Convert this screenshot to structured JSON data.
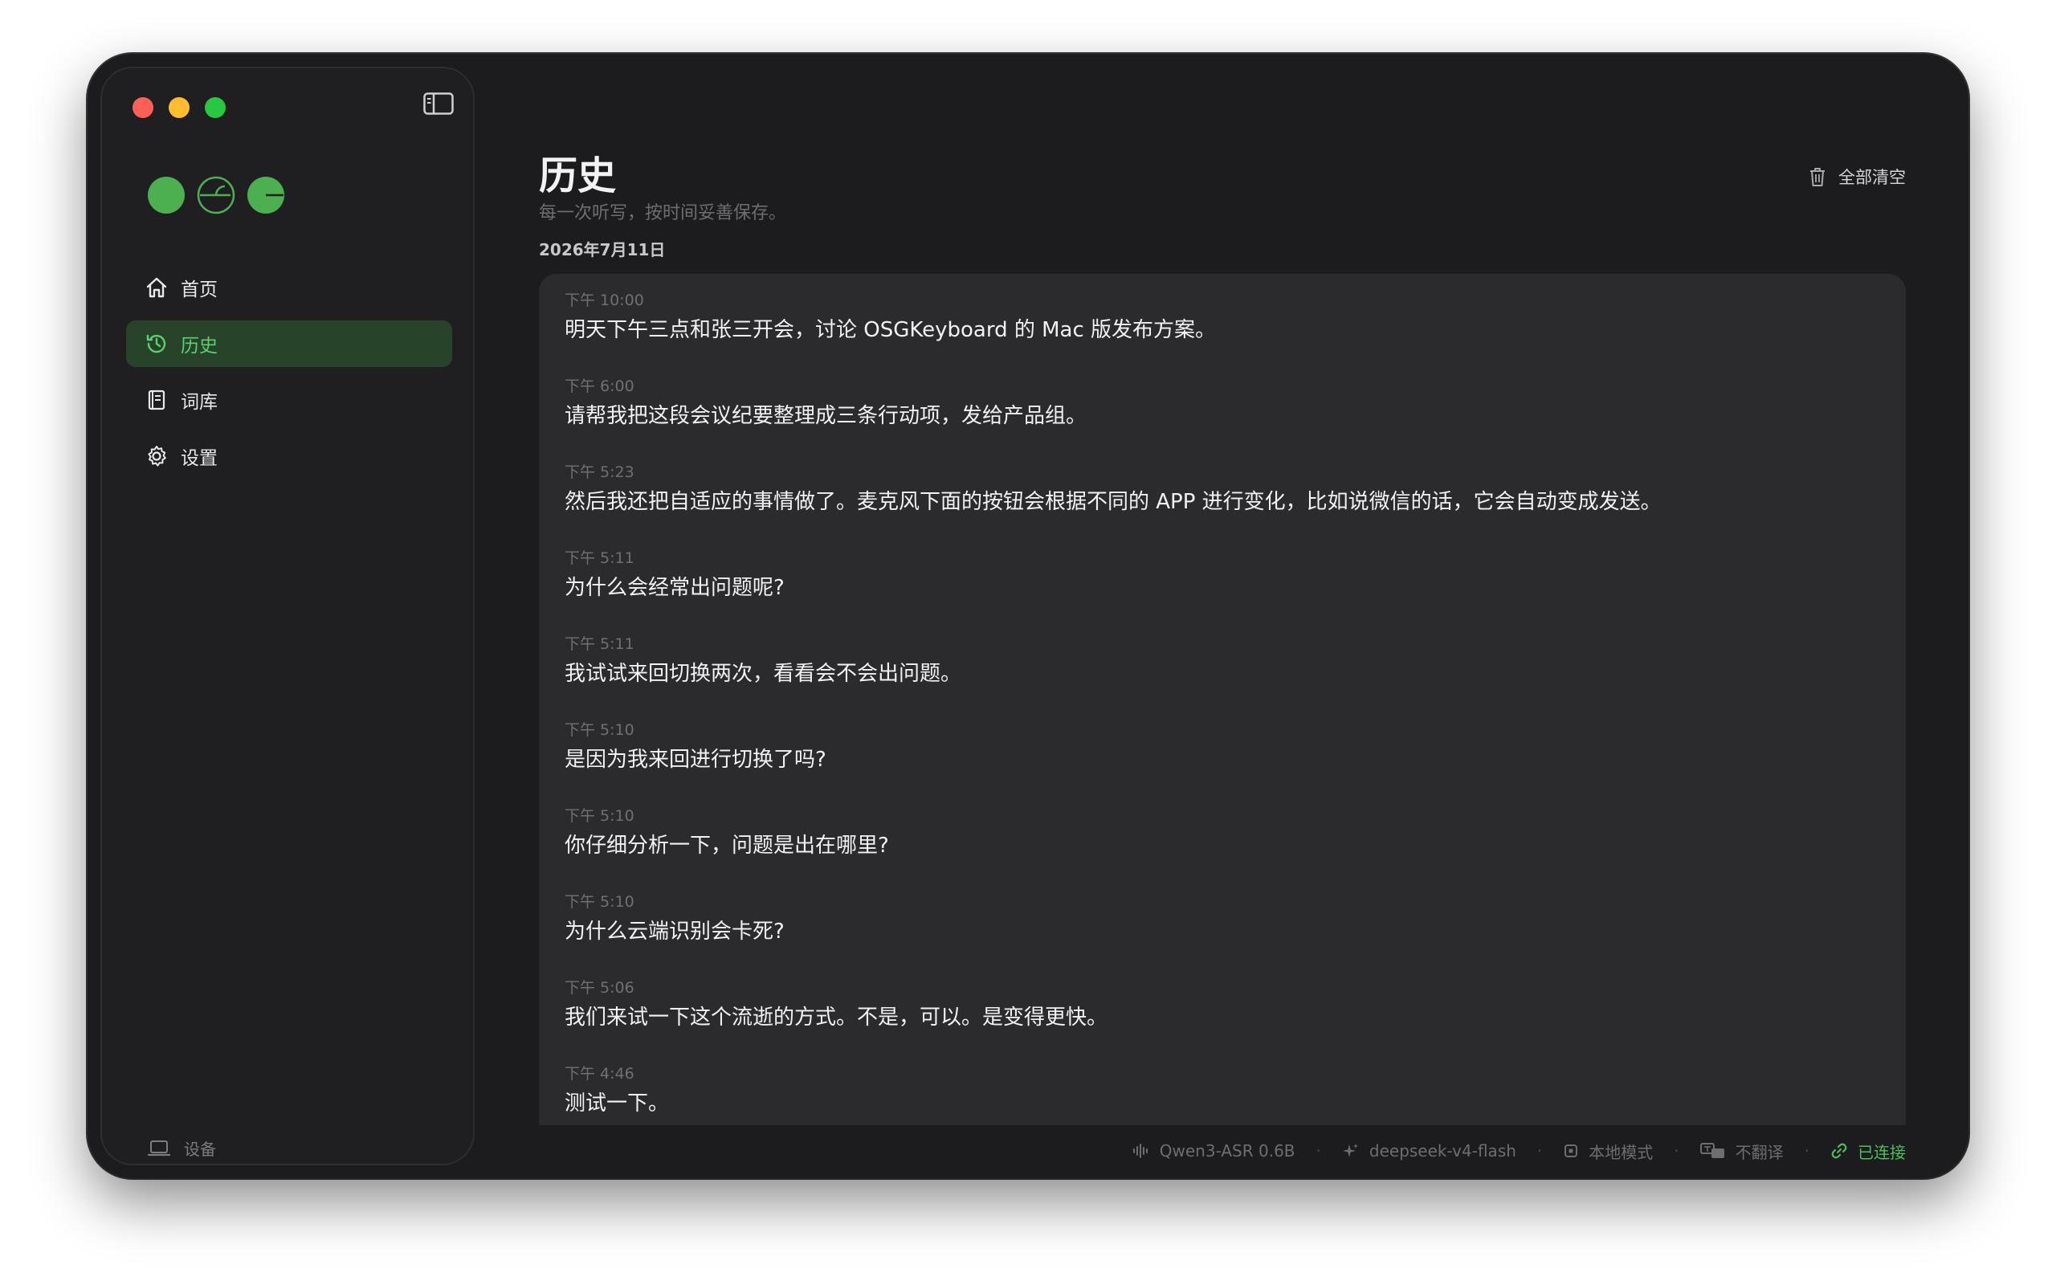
{
  "sidebar": {
    "nav": [
      {
        "label": "首页",
        "icon": "home-icon"
      },
      {
        "label": "历史",
        "icon": "history-icon"
      },
      {
        "label": "词库",
        "icon": "book-icon"
      },
      {
        "label": "设置",
        "icon": "gear-icon"
      }
    ],
    "active": "历史",
    "device_label": "设备"
  },
  "header": {
    "title": "历史",
    "subtitle": "每一次听写，按时间妥善保存。",
    "clear_all": "全部清空"
  },
  "history": {
    "date": "2026年7月11日",
    "entries": [
      {
        "time": "下午 10:00",
        "text": "明天下午三点和张三开会，讨论 OSGKeyboard 的 Mac 版发布方案。"
      },
      {
        "time": "下午 6:00",
        "text": "请帮我把这段会议纪要整理成三条行动项，发给产品组。"
      },
      {
        "time": "下午 5:23",
        "text": "然后我还把自适应的事情做了。麦克风下面的按钮会根据不同的 APP 进行变化，比如说微信的话，它会自动变成发送。"
      },
      {
        "time": "下午 5:11",
        "text": "为什么会经常出问题呢?"
      },
      {
        "time": "下午 5:11",
        "text": "我试试来回切换两次，看看会不会出问题。"
      },
      {
        "time": "下午 5:10",
        "text": "是因为我来回进行切换了吗?"
      },
      {
        "time": "下午 5:10",
        "text": "你仔细分析一下，问题是出在哪里?"
      },
      {
        "time": "下午 5:10",
        "text": "为什么云端识别会卡死?"
      },
      {
        "time": "下午 5:06",
        "text": "我们来试一下这个流逝的方式。不是，可以。是变得更快。"
      },
      {
        "time": "下午 4:46",
        "text": "测试一下。"
      }
    ]
  },
  "status": {
    "asr_model": "Qwen3-ASR 0.6B",
    "llm_model": "deepseek-v4-flash",
    "mode": "本地模式",
    "translate": "不翻译",
    "connection": "已连接"
  },
  "colors": {
    "accent_green": "#5fcf6b",
    "active_bg": "#27442b",
    "window_bg": "#1c1c1e",
    "card_bg": "#2b2b2e"
  }
}
